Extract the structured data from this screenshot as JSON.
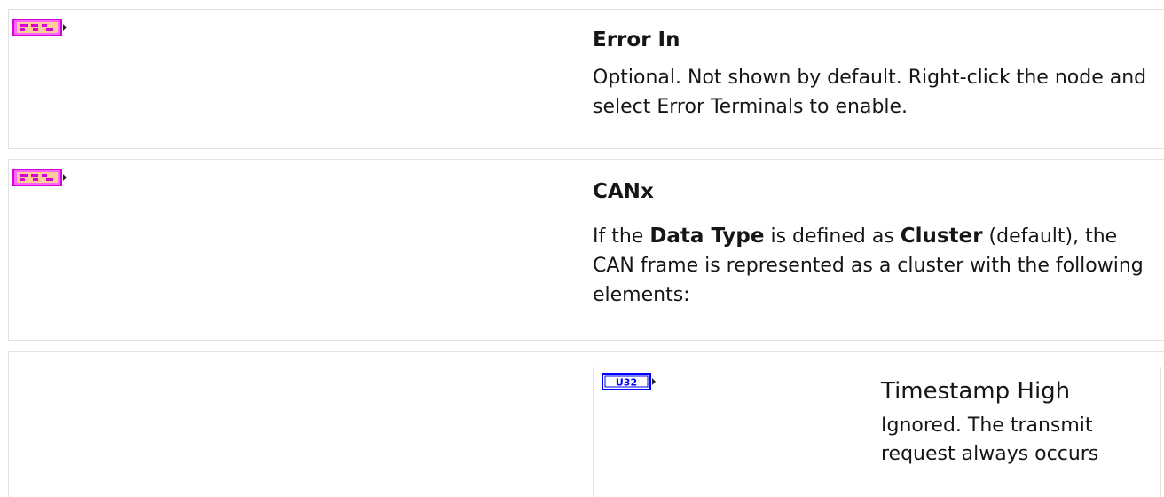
{
  "params": [
    {
      "icon": "error-cluster-icon",
      "name": "Error In",
      "description": "Optional. Not shown by default. Right-click the node and select Error Terminals to enable."
    },
    {
      "icon": "cluster-icon",
      "name_plain": "CAN",
      "name_bold": "x",
      "desc_part1": "If the ",
      "desc_em1": "Data Type",
      "desc_part2": " is defined as ",
      "desc_em2": "Cluster",
      "desc_part3": " (default), the CAN frame is represented as a cluster with the following elements:"
    }
  ],
  "sub_params": [
    {
      "icon": "u32-icon",
      "icon_label": "U32",
      "name": "Timestamp High",
      "description": "Ignored. The transmit request always occurs"
    }
  ],
  "colors": {
    "cluster_icon_border": "#d400d4",
    "cluster_icon_fill": "#ffcc99",
    "u32_icon_border": "#0000ff",
    "row_border": "#e2e2e2"
  }
}
